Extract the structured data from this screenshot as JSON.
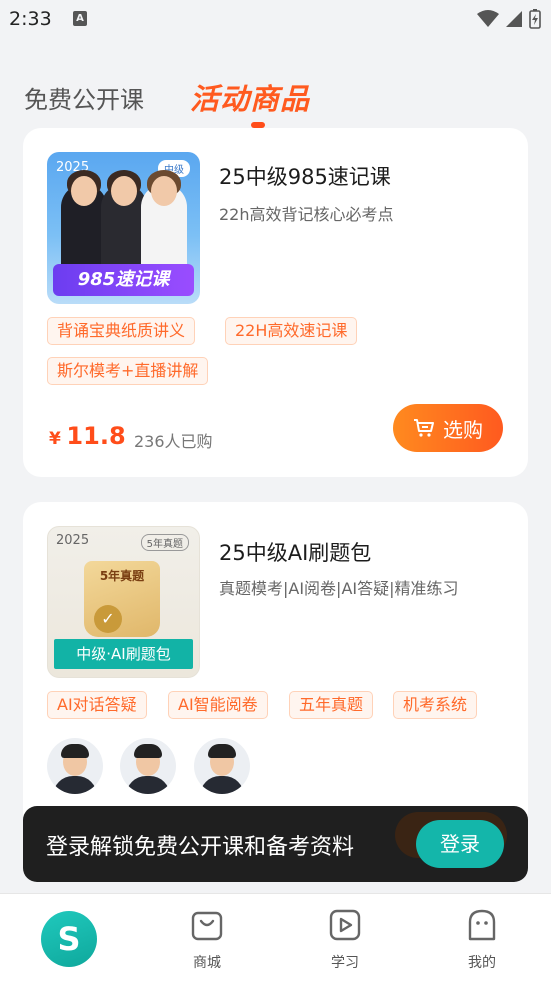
{
  "status_bar": {
    "time": "2:33"
  },
  "tabs": {
    "free": "免费公开课",
    "active": "活动商品"
  },
  "products": [
    {
      "thumb_year": "2025",
      "thumb_badge": "中级",
      "thumb_banner": "985速记课",
      "title": "25中级985速记课",
      "subtitle": "22h高效背记核心必考点",
      "tags": [
        "背诵宝典纸质讲义",
        "22H高效速记课",
        "斯尔模考+直播讲解"
      ],
      "price_currency": "¥",
      "price": "11.8",
      "sold": "236人已购",
      "buy_label": "选购"
    },
    {
      "thumb_year": "2025",
      "thumb_badge": "5年真题",
      "thumb_art_text": "5年真题",
      "thumb_banner": "中级·AI刷题包",
      "title": "25中级AI刷题包",
      "subtitle": "真题模考|AI阅卷|AI答疑|精准练习",
      "tags": [
        "AI对话答疑",
        "AI智能阅卷",
        "五年真题",
        "机考系统"
      ]
    }
  ],
  "toast": {
    "text": "登录解锁免费公开课和备考资料",
    "button": "登录"
  },
  "bottom_nav": {
    "mall": "商城",
    "study": "学习",
    "mine": "我的"
  },
  "colors": {
    "accent": "#ff5a1f",
    "teal": "#14b6aa"
  }
}
